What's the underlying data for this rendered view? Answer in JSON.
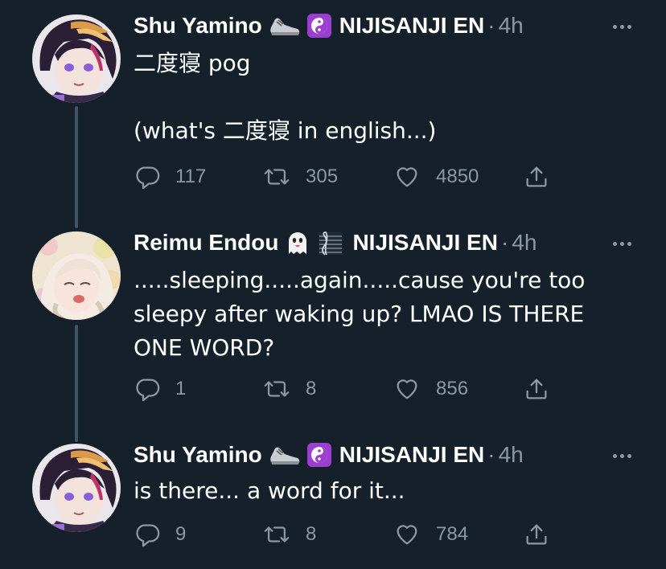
{
  "tweets": [
    {
      "author": "Shu Yamino",
      "handle_tag": "NIJISANJI EN",
      "separator": "·",
      "time": "4h",
      "emojis": [
        "sneaker-icon",
        "yin-yang-icon"
      ],
      "text": "二度寝 pog\n\n(what's 二度寝 in english...)",
      "replies": "117",
      "retweets": "305",
      "likes": "4850"
    },
    {
      "author": "Reimu Endou",
      "handle_tag": "NIJISANJI EN",
      "separator": "·",
      "time": "4h",
      "emojis": [
        "ghost-icon",
        "music-staff-icon"
      ],
      "text": ".....sleeping.....again.....cause you're too sleepy after waking up? LMAO IS THERE ONE WORD?",
      "replies": "1",
      "retweets": "8",
      "likes": "856"
    },
    {
      "author": "Shu Yamino",
      "handle_tag": "NIJISANJI EN",
      "separator": "·",
      "time": "4h",
      "emojis": [
        "sneaker-icon",
        "yin-yang-icon"
      ],
      "text": "is there... a word for it...",
      "replies": "9",
      "retweets": "8",
      "likes": "784"
    }
  ],
  "colors": {
    "background": "#15202b",
    "text": "#ffffff",
    "muted": "#8b98a5",
    "thread_line": "#3d5466",
    "yin_yang_bg": "#9b3fd0"
  }
}
